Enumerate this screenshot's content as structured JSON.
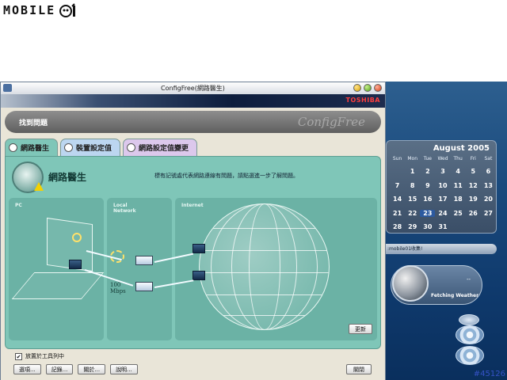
{
  "watermark": {
    "text": "MOBILE"
  },
  "window": {
    "title": "ConfigFree(網路醫生)",
    "brand": "TOSHIBA",
    "topbar_title": "找到問題",
    "topbar_logo": "ConfigFree"
  },
  "tabs": [
    {
      "label": "網路醫生"
    },
    {
      "label": "裝置設定值"
    },
    {
      "label": "網路設定值變更"
    }
  ],
  "panel": {
    "title": "網路醫生",
    "message": "標有記號處代表網路連線有問題，請點選進一步了解問題。",
    "sections": {
      "pc": "PC",
      "local": [
        "Local",
        "Network"
      ],
      "internet": "Internet"
    },
    "speed": [
      "100",
      "Mbps"
    ],
    "refresh_label": "更新"
  },
  "footer": {
    "checkbox_label": "放置於工具列中",
    "buttons": [
      "選項...",
      "記錄...",
      "關於...",
      "說明..."
    ],
    "close_label": "關閉"
  },
  "calendar": {
    "title": "August 2005",
    "day_headers": [
      "Sun",
      "Mon",
      "Tue",
      "Wed",
      "Thu",
      "Fri",
      "Sat"
    ],
    "days": [
      "",
      "1",
      "2",
      "3",
      "4",
      "5",
      "6",
      "7",
      "8",
      "9",
      "10",
      "11",
      "12",
      "13",
      "14",
      "15",
      "16",
      "17",
      "18",
      "19",
      "20",
      "21",
      "22",
      "23",
      "24",
      "25",
      "26",
      "27",
      "28",
      "29",
      "30",
      "31",
      "",
      "",
      ""
    ],
    "today": "23"
  },
  "desktop": {
    "widget_title": ":mobile01收集!",
    "weather_text": "Fetching Weather",
    "weather_dash": "--",
    "stamp": "#45126"
  }
}
